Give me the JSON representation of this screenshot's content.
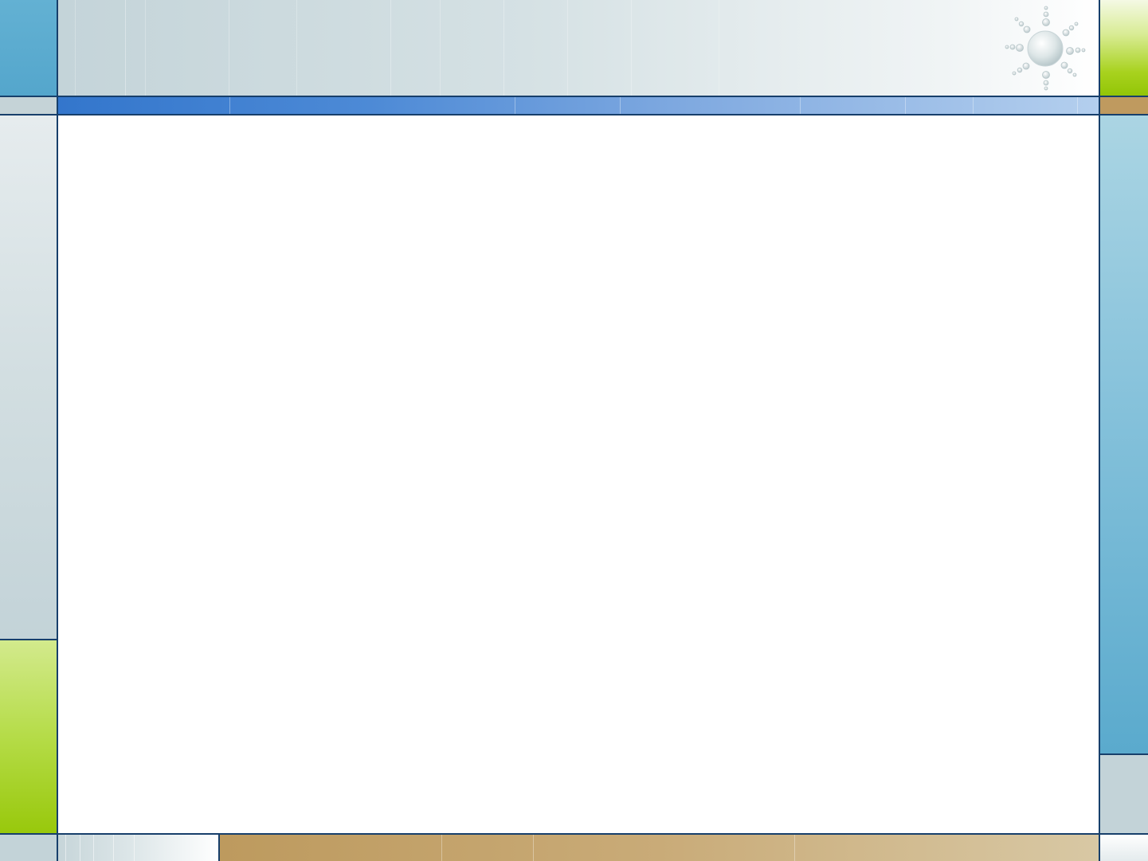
{
  "template": {
    "name": "slide-background-template",
    "colors": {
      "navy_border": "#173f6b",
      "sky_blue": "#5aaace",
      "blue_band_start": "#3478cc",
      "blue_band_end": "#b3cfee",
      "lime_top": "#eef6d2",
      "lime_bottom": "#96c808",
      "tan_start": "#bd9a5e",
      "tan_end": "#d8c8a4",
      "grey_blue": "#c3d3d8",
      "content_white": "#ffffff"
    },
    "icons": [
      "sun-bubbles-icon"
    ],
    "content_area": {
      "text": ""
    }
  }
}
